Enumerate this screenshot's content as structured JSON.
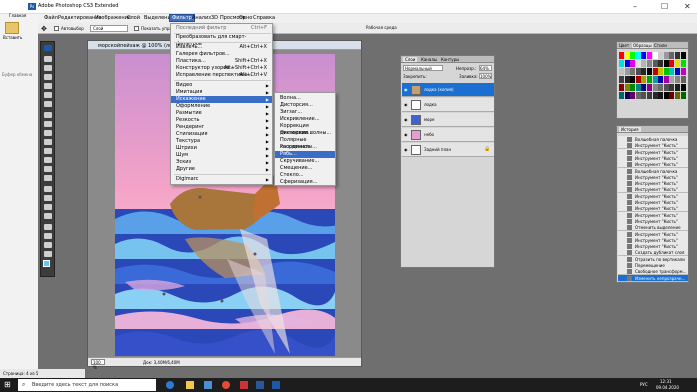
{
  "window": {
    "title": "Adobe Photoshop CS3 Extended"
  },
  "menu": [
    "Файл",
    "Редактирование",
    "Изображение",
    "Слой",
    "Выделение",
    "Фильтр",
    "Анализ",
    "3D",
    "Просмотр",
    "Окно",
    "Справка"
  ],
  "optbar": {
    "auto_select": "Автовыбор",
    "layer_value": "Слой",
    "show_transform": "Показать управ",
    "workspace": "Рабочая среда"
  },
  "left_panel": {
    "paste": "Вставить",
    "clipboard": "Буфер обмена",
    "home": "Главная"
  },
  "document": {
    "title": "морскойпейзаж @ 100% (лодка (копия), RGB/8)",
    "zoom": "100 %",
    "doc_size": "Док: 3,40M/6,40M"
  },
  "filter_menu": [
    {
      "label": "Последний фильтр",
      "shortcut": "Ctrl+F"
    },
    {
      "label": "Преобразовать для смарт-фильтров",
      "shortcut": ""
    },
    {
      "label": "Извлечь...",
      "shortcut": "Alt+Ctrl+X"
    },
    {
      "label": "Галерея фильтров...",
      "shortcut": ""
    },
    {
      "label": "Пластика...",
      "shortcut": "Shift+Ctrl+X"
    },
    {
      "label": "Конструктор узоров...",
      "shortcut": "Alt+Shift+Ctrl+X"
    },
    {
      "label": "Исправление перспективы...",
      "shortcut": "Alt+Ctrl+V"
    },
    {
      "label": "Видео",
      "shortcut": ""
    },
    {
      "label": "Имитация",
      "shortcut": ""
    },
    {
      "label": "Искажение",
      "shortcut": ""
    },
    {
      "label": "Оформление",
      "shortcut": ""
    },
    {
      "label": "Размытие",
      "shortcut": ""
    },
    {
      "label": "Резкость",
      "shortcut": ""
    },
    {
      "label": "Рендеринг",
      "shortcut": ""
    },
    {
      "label": "Стилизация",
      "shortcut": ""
    },
    {
      "label": "Текстура",
      "shortcut": ""
    },
    {
      "label": "Штрихи",
      "shortcut": ""
    },
    {
      "label": "Шум",
      "shortcut": ""
    },
    {
      "label": "Эскиз",
      "shortcut": ""
    },
    {
      "label": "Другие",
      "shortcut": ""
    },
    {
      "label": "Digimarc",
      "shortcut": ""
    }
  ],
  "distort_submenu": [
    "Волна...",
    "Дисторсия...",
    "Зигзаг...",
    "Искривление...",
    "Коррекция дисторсии...",
    "Океанские волны...",
    "Полярные координаты...",
    "Рассеянное свечение...",
    "Рябь...",
    "Скручивание...",
    "Смещение...",
    "Стекло...",
    "Сферизация..."
  ],
  "layers_panel": {
    "tabs": [
      "Слои",
      "Каналы",
      "Контуры"
    ],
    "mode": "Нормальный",
    "opacity_label": "Непрозр.:",
    "opacity": "64%",
    "lock_label": "Закрепить:",
    "fill_label": "Заливка:",
    "fill": "100%",
    "layers": [
      "лодка (копия)",
      "лодка",
      "море",
      "небо",
      "Задний план"
    ]
  },
  "swatches": {
    "tabs": [
      "Цвет",
      "Образцы",
      "Стили"
    ]
  },
  "history": {
    "title": "История",
    "items": [
      "Волшебная палочка",
      "Инструмент \"Кисть\"",
      "Инструмент \"Кисть\"",
      "Инструмент \"Кисть\"",
      "Инструмент \"Кисть\"",
      "Волшебная палочка",
      "Инструмент \"Кисть\"",
      "Инструмент \"Кисть\"",
      "Инструмент \"Кисть\"",
      "Инструмент \"Кисть\"",
      "Инструмент \"Кисть\"",
      "Инструмент \"Кисть\"",
      "Инструмент \"Кисть\"",
      "Инструмент \"Кисть\"",
      "Отменить выделение",
      "Инструмент \"Кисть\"",
      "Инструмент \"Кисть\"",
      "Инструмент \"Кисть\"",
      "Создать дубликат слоя",
      "Отразить по вертикали",
      "Перемещение",
      "Свободное трансформ...",
      "Изменить непрозрачн..."
    ]
  },
  "statusbar": {
    "page": "Страница: 4 из 5"
  },
  "taskbar": {
    "search": "Введите здесь текст для поиска",
    "time": "12:31",
    "date": "09.04.2020",
    "lang": "РУС"
  }
}
